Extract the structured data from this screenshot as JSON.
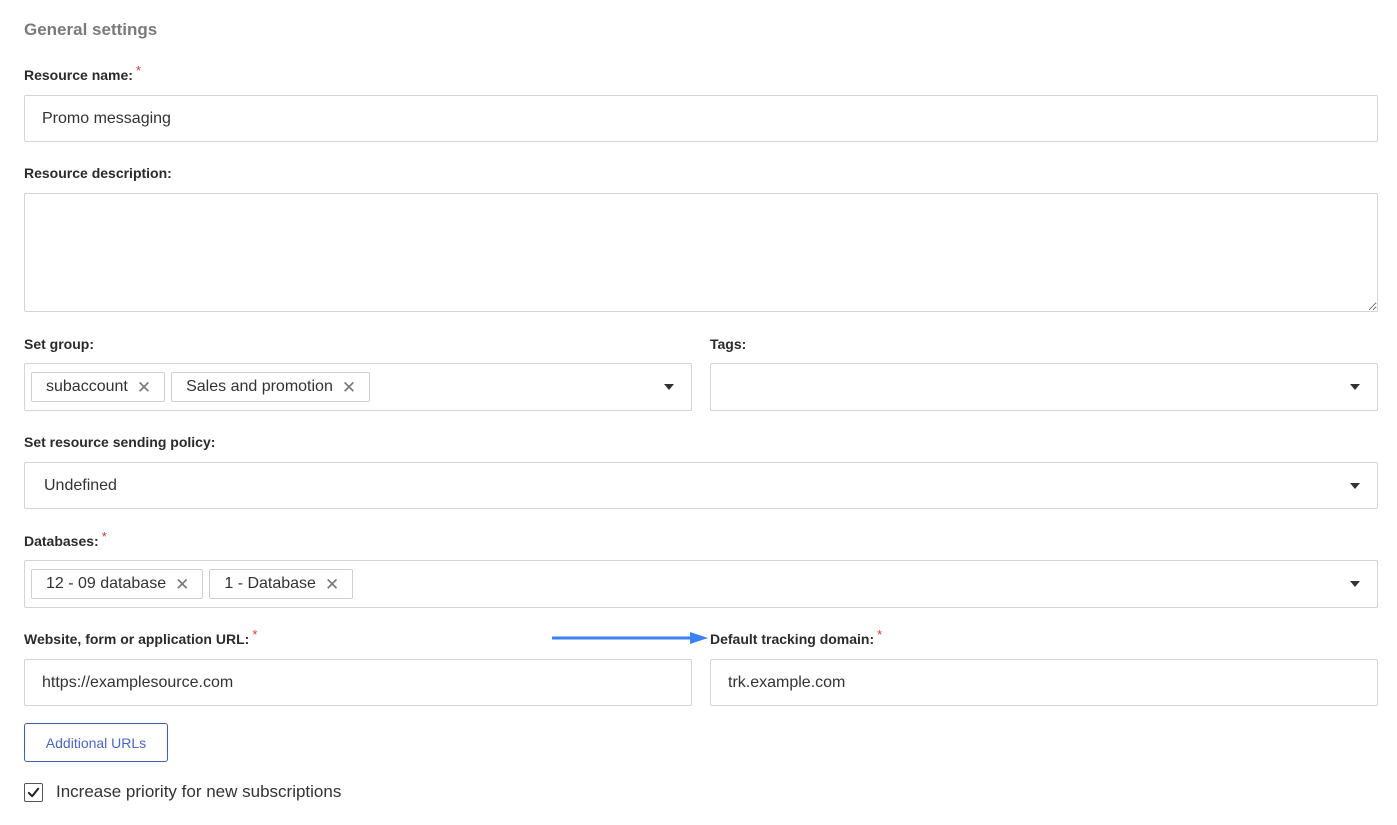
{
  "section": {
    "title": "General settings"
  },
  "resource_name": {
    "label": "Resource name:",
    "required": "*",
    "value": "Promo messaging"
  },
  "resource_description": {
    "label": "Resource description:",
    "value": ""
  },
  "set_group": {
    "label": "Set group:",
    "chips": [
      "subaccount",
      "Sales and promotion"
    ],
    "remove_glyph": "✕"
  },
  "tags": {
    "label": "Tags:"
  },
  "sending_policy": {
    "label": "Set resource sending policy:",
    "value": "Undefined"
  },
  "databases": {
    "label": "Databases:",
    "required": "*",
    "chips": [
      "12 - 09 database",
      "1 - Database"
    ],
    "remove_glyph": "✕"
  },
  "website_url": {
    "label": "Website, form or application URL:",
    "required": "*",
    "value": "https://examplesource.com"
  },
  "tracking_domain": {
    "label": "Default tracking domain:",
    "required": "*",
    "value": "trk.example.com"
  },
  "additional_urls": {
    "label": "Additional URLs"
  },
  "priority": {
    "label": "Increase priority for new subscriptions",
    "checked": true
  },
  "colors": {
    "accent": "#4b67c2",
    "required": "#d23b3b",
    "annotation_arrow": "#3b82f6"
  }
}
